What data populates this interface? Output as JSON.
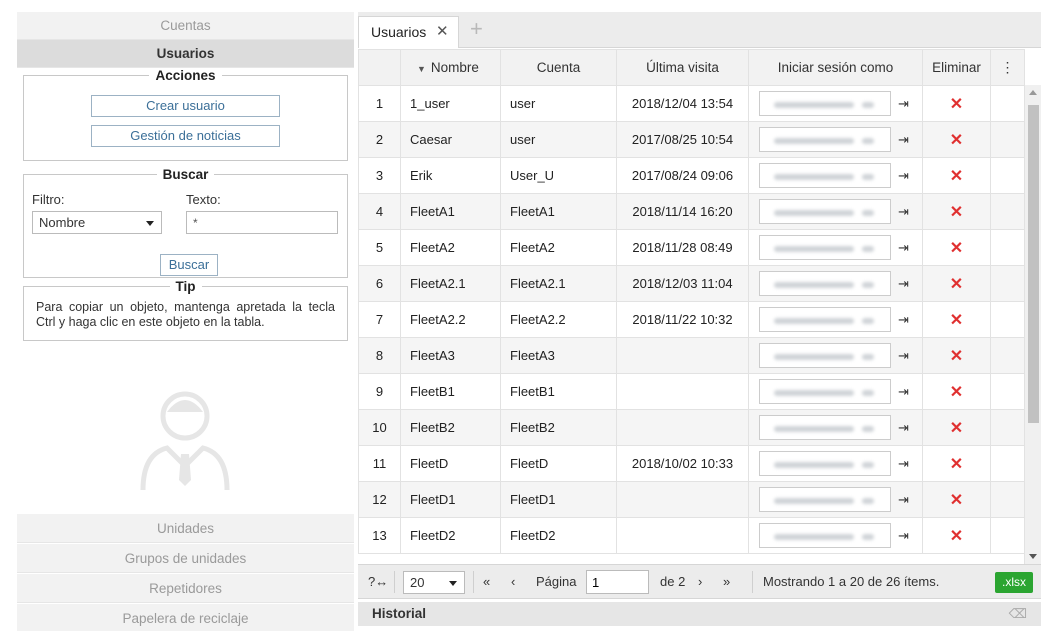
{
  "sidebar": {
    "top_items": [
      "Cuentas",
      "Usuarios"
    ],
    "acciones": {
      "title": "Acciones",
      "crear_usuario": "Crear usuario",
      "gestion_noticias": "Gestión de noticias"
    },
    "buscar": {
      "title": "Buscar",
      "filtro_label": "Filtro:",
      "texto_label": "Texto:",
      "filtro_value": "Nombre",
      "texto_value": "*",
      "button": "Buscar"
    },
    "tip": {
      "title": "Tip",
      "text": "Para copiar un objeto, mantenga apretada la tecla Ctrl y haga clic en este objeto en la tabla."
    },
    "bottom_items": [
      "Unidades",
      "Grupos de unidades",
      "Repetidores",
      "Papelera de reciclaje"
    ]
  },
  "tabs": {
    "active": "Usuarios",
    "close_icon": "close-icon",
    "add_icon": "plus-icon"
  },
  "table": {
    "headers": {
      "nombre": "Nombre",
      "cuenta": "Cuenta",
      "ultima_visita": "Última visita",
      "iniciar_sesion": "Iniciar sesión como",
      "eliminar": "Eliminar",
      "menu": "⋮"
    },
    "rows": [
      {
        "n": "1",
        "nombre": "1_user",
        "cuenta": "user",
        "visita": "2018/12/04 13:54"
      },
      {
        "n": "2",
        "nombre": "Caesar",
        "cuenta": "user",
        "visita": "2017/08/25 10:54"
      },
      {
        "n": "3",
        "nombre": "Erik",
        "cuenta": "User_U",
        "visita": "2017/08/24 09:06"
      },
      {
        "n": "4",
        "nombre": "FleetA1",
        "cuenta": "FleetA1",
        "visita": "2018/11/14 16:20"
      },
      {
        "n": "5",
        "nombre": "FleetA2",
        "cuenta": "FleetA2",
        "visita": "2018/11/28 08:49"
      },
      {
        "n": "6",
        "nombre": "FleetA2.1",
        "cuenta": "FleetA2.1",
        "visita": "2018/12/03 11:04"
      },
      {
        "n": "7",
        "nombre": "FleetA2.2",
        "cuenta": "FleetA2.2",
        "visita": "2018/11/22 10:32"
      },
      {
        "n": "8",
        "nombre": "FleetA3",
        "cuenta": "FleetA3",
        "visita": ""
      },
      {
        "n": "9",
        "nombre": "FleetB1",
        "cuenta": "FleetB1",
        "visita": ""
      },
      {
        "n": "10",
        "nombre": "FleetB2",
        "cuenta": "FleetB2",
        "visita": ""
      },
      {
        "n": "11",
        "nombre": "FleetD",
        "cuenta": "FleetD",
        "visita": "2018/10/02 10:33"
      },
      {
        "n": "12",
        "nombre": "FleetD1",
        "cuenta": "FleetD1",
        "visita": ""
      },
      {
        "n": "13",
        "nombre": "FleetD2",
        "cuenta": "FleetD2",
        "visita": ""
      }
    ],
    "delete_glyph": "✕",
    "login_glyph": "⇥"
  },
  "pager": {
    "help": "?",
    "page_size": "20",
    "first": "«",
    "prev": "‹",
    "page_label": "Página",
    "page_value": "1",
    "of_label": "de 2",
    "next": "›",
    "last": "»",
    "showing": "Mostrando 1 a 20 de 26 ítems.",
    "xlsx": ".xlsx"
  },
  "historial": {
    "title": "Historial",
    "icon": "eraser-icon"
  },
  "colors": {
    "delete": "#e03030",
    "xlsx": "#2ba531",
    "link_blue": "#3b6f98"
  }
}
